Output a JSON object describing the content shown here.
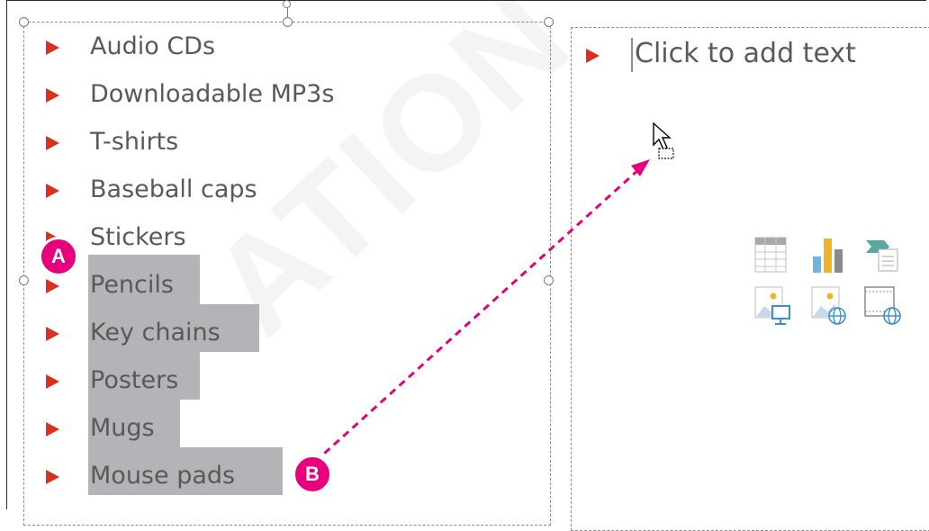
{
  "slide": {
    "left_list": [
      {
        "label": "Audio CDs",
        "selected": false
      },
      {
        "label": "Downloadable MP3s",
        "selected": false
      },
      {
        "label": "T-shirts",
        "selected": false
      },
      {
        "label": "Baseball caps",
        "selected": false
      },
      {
        "label": "Stickers",
        "selected": false
      },
      {
        "label": "Pencils",
        "selected": true
      },
      {
        "label": "Key chains",
        "selected": true
      },
      {
        "label": "Posters",
        "selected": true
      },
      {
        "label": "Mugs",
        "selected": true
      },
      {
        "label": "Mouse pads",
        "selected": true
      }
    ],
    "right_placeholder": {
      "text": "Click to add text"
    },
    "content_icons": [
      {
        "icon": "insert-table-icon"
      },
      {
        "icon": "insert-chart-icon"
      },
      {
        "icon": "insert-smartart-icon"
      },
      {
        "icon": "insert-picture-icon"
      },
      {
        "icon": "insert-online-picture-icon"
      },
      {
        "icon": "insert-video-icon"
      }
    ]
  },
  "annotations": {
    "callout_a": "A",
    "callout_b": "B"
  },
  "watermark": "ATION ONLY",
  "colors": {
    "bullet": "#d8321f",
    "selection": "#b3b4b8",
    "callout": "#e6007e",
    "text": "#595959"
  }
}
